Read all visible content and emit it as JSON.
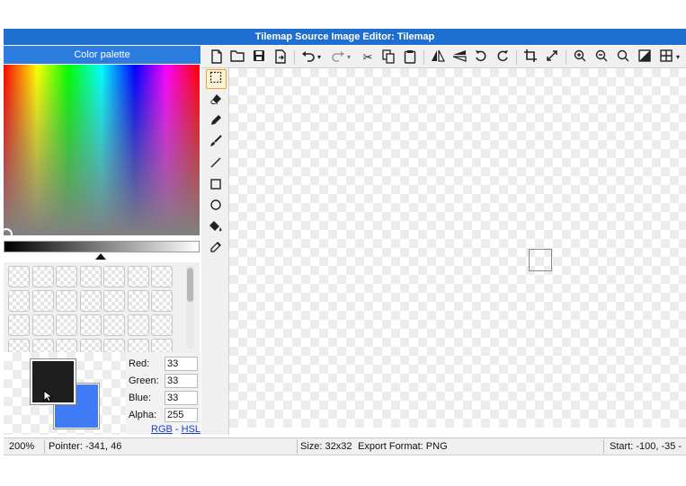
{
  "window": {
    "title": "Tilemap Source Image Editor: Tilemap"
  },
  "palette": {
    "header": "Color palette",
    "foreground": "#1e1e1e",
    "background": "#3e7bf5",
    "fields": [
      {
        "label": "Red:",
        "value": "33"
      },
      {
        "label": "Green:",
        "value": "33"
      },
      {
        "label": "Blue:",
        "value": "33"
      },
      {
        "label": "Alpha:",
        "value": "255"
      }
    ],
    "mode_links": {
      "rgb": "RGB",
      "separator": " - ",
      "hsl": "HSL"
    }
  },
  "toolbar": {
    "icons": [
      "new-file-icon",
      "open-folder-icon",
      "save-icon",
      "export-icon",
      "undo-icon",
      "redo-icon",
      "cut-icon",
      "copy-icon",
      "paste-icon",
      "flip-horizontal-icon",
      "flip-vertical-icon",
      "rotate-left-icon",
      "rotate-right-icon",
      "crop-icon",
      "resize-icon",
      "zoom-in-icon",
      "zoom-out-icon",
      "zoom-reset-icon",
      "invert-icon",
      "grid-icon"
    ]
  },
  "tools": {
    "selected": "select-tool",
    "items": [
      "select-tool",
      "eraser-tool",
      "pencil-tool",
      "brush-tool",
      "line-tool",
      "rectangle-tool",
      "ellipse-tool",
      "fill-tool",
      "eyedropper-tool"
    ]
  },
  "status": {
    "zoom": "200%",
    "pointer": "Pointer: -341, 46",
    "size": "Size: 32x32",
    "export_format": "Export Format: PNG",
    "start": "Start: -100, -35 -"
  }
}
